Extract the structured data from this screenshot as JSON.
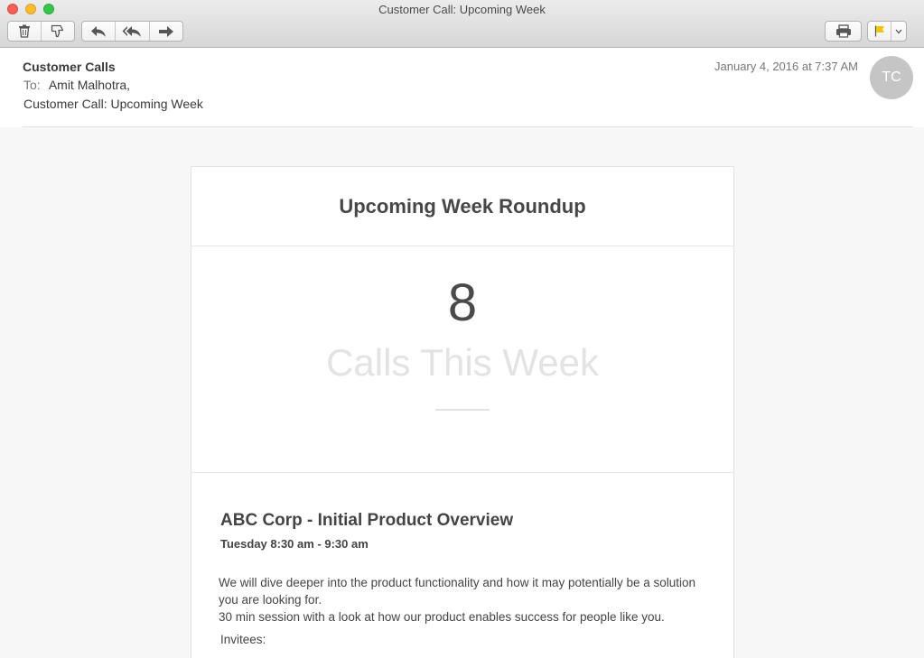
{
  "window": {
    "title": "Customer Call: Upcoming Week"
  },
  "toolbar": {
    "delete_icon": "trash-icon",
    "junk_icon": "thumbs-down-icon",
    "reply_icon": "reply-icon",
    "reply_all_icon": "reply-all-icon",
    "forward_icon": "forward-icon",
    "print_icon": "printer-icon",
    "flag_icon": "flag-icon",
    "flag_color": "#f5c400"
  },
  "message": {
    "sender": "Customer Calls",
    "to_label": "To:",
    "to_value": "Amit Malhotra,",
    "subject": "Customer Call: Upcoming Week",
    "date": "January 4, 2016 at 7:37 AM",
    "avatar_initials": "TC"
  },
  "email_body": {
    "heading": "Upcoming Week Roundup",
    "calls_count": "8",
    "calls_label": "Calls This Week",
    "event": {
      "title": "ABC Corp - Initial Product Overview",
      "time": "Tuesday 8:30 am - 9:30 am",
      "description_line1": "We will dive deeper into the product functionality and how it may potentially be a solution you are looking for.",
      "description_line2": "30 min session with a look at how our product enables success for people like you.",
      "invitees_label": "Invitees:"
    }
  }
}
